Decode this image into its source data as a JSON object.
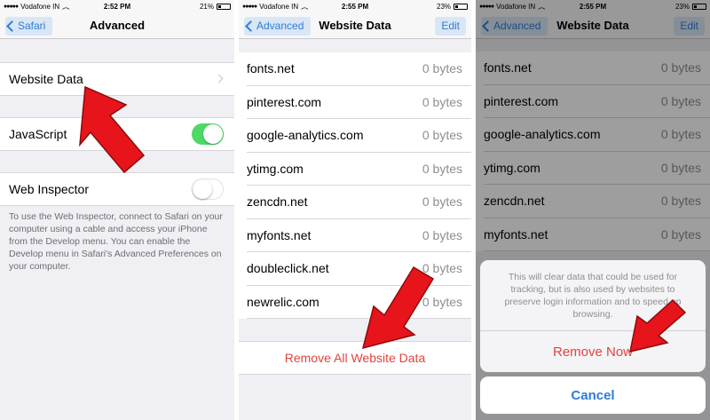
{
  "panels": [
    {
      "status": {
        "carrier": "Vodafone IN",
        "time": "2:52 PM",
        "battery": "21%",
        "battery_fill": 0.21
      },
      "nav": {
        "back": "Safari",
        "title": "Advanced"
      },
      "cells": {
        "website_data": "Website Data",
        "javascript": "JavaScript",
        "javascript_on": true,
        "web_inspector": "Web Inspector",
        "web_inspector_on": false
      },
      "help": "To use the Web Inspector, connect to Safari on your computer using a cable and access your iPhone from the Develop menu. You can enable the Develop menu in Safari's Advanced Preferences on your computer."
    },
    {
      "status": {
        "carrier": "Vodafone IN",
        "time": "2:55 PM",
        "battery": "23%",
        "battery_fill": 0.23
      },
      "nav": {
        "back": "Advanced",
        "title": "Website Data",
        "edit": "Edit"
      },
      "rows": [
        {
          "domain": "fonts.net",
          "size": "0 bytes"
        },
        {
          "domain": "pinterest.com",
          "size": "0 bytes"
        },
        {
          "domain": "google-analytics.com",
          "size": "0 bytes"
        },
        {
          "domain": "ytimg.com",
          "size": "0 bytes"
        },
        {
          "domain": "zencdn.net",
          "size": "0 bytes"
        },
        {
          "domain": "myfonts.net",
          "size": "0 bytes"
        },
        {
          "domain": "doubleclick.net",
          "size": "0 bytes"
        },
        {
          "domain": "newrelic.com",
          "size": "0 bytes"
        }
      ],
      "remove_all": "Remove All Website Data"
    },
    {
      "status": {
        "carrier": "Vodafone IN",
        "time": "2:55 PM",
        "battery": "23%",
        "battery_fill": 0.23
      },
      "nav": {
        "back": "Advanced",
        "title": "Website Data",
        "edit": "Edit"
      },
      "rows": [
        {
          "domain": "fonts.net",
          "size": "0 bytes"
        },
        {
          "domain": "pinterest.com",
          "size": "0 bytes"
        },
        {
          "domain": "google-analytics.com",
          "size": "0 bytes"
        },
        {
          "domain": "ytimg.com",
          "size": "0 bytes"
        },
        {
          "domain": "zencdn.net",
          "size": "0 bytes"
        },
        {
          "domain": "myfonts.net",
          "size": "0 bytes"
        }
      ],
      "sheet": {
        "message": "This will clear data that could be used for tracking, but is also used by websites to preserve login information and to speed up browsing.",
        "action": "Remove Now",
        "cancel": "Cancel"
      }
    }
  ],
  "colors": {
    "accent_blue": "#2e7dd6",
    "destructive_red": "#e0443b",
    "toggle_green": "#4cd964",
    "arrow_red": "#e8141b"
  }
}
